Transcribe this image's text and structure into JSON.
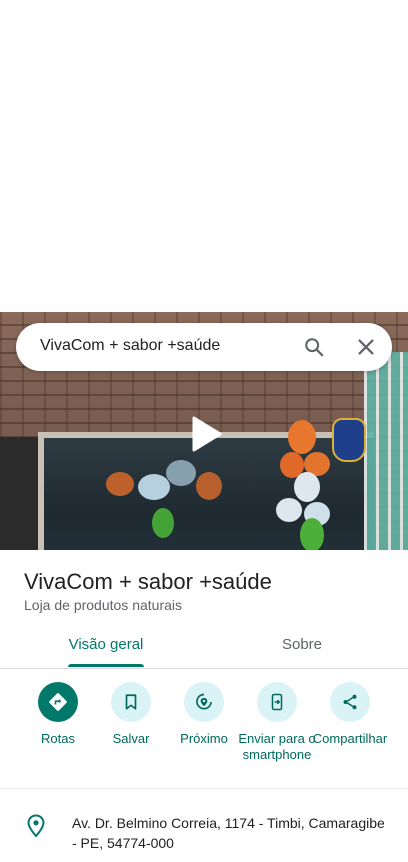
{
  "search": {
    "query": "VivaCom + sabor +saúde"
  },
  "place": {
    "name": "VivaCom + sabor +saúde",
    "category": "Loja de produtos naturais",
    "address": "Av. Dr. Belmino Correia, 1174 - Timbi, Camaragibe - PE, 54774-000"
  },
  "tabs": [
    {
      "label": "Visão geral",
      "active": true
    },
    {
      "label": "Sobre",
      "active": false
    }
  ],
  "actions": [
    {
      "label": "Rotas",
      "icon": "directions-icon"
    },
    {
      "label": "Salvar",
      "icon": "bookmark-icon"
    },
    {
      "label": "Próximo",
      "icon": "nearby-icon"
    },
    {
      "label": "Enviar para o smartphone",
      "icon": "send-to-phone-icon"
    },
    {
      "label": "Compartilhar",
      "icon": "share-icon"
    }
  ],
  "colors": {
    "accent": "#00796b",
    "accent_light": "#d9f3f7",
    "text_primary": "#202124",
    "text_secondary": "#5f6368"
  }
}
